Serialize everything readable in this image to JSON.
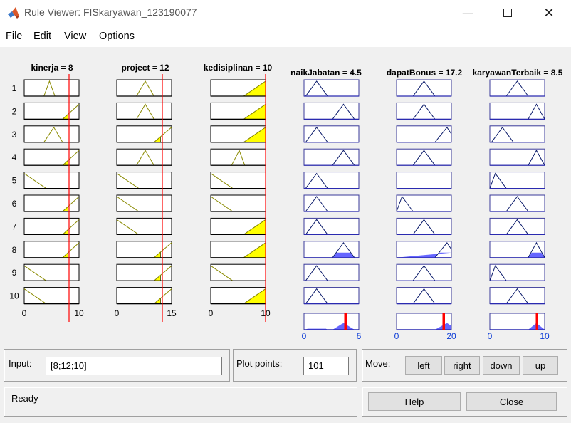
{
  "window": {
    "title": "Rule Viewer: FISkaryawan_123190077"
  },
  "menu": [
    "File",
    "Edit",
    "View",
    "Options"
  ],
  "columns": [
    {
      "label": "kinerja = 8",
      "range": [
        "0",
        "10"
      ]
    },
    {
      "label": "project = 12",
      "range": [
        "0",
        "15"
      ]
    },
    {
      "label": "kedisiplinan = 10",
      "range": [
        "0",
        "10"
      ]
    },
    {
      "label": "naikJabatan = 4.5",
      "range": [
        "0",
        "6"
      ]
    },
    {
      "label": "dapatBonus = 17.2",
      "range": [
        "0",
        "20"
      ]
    },
    {
      "label": "karyawanTerbaik = 8.5",
      "range": [
        "0",
        "10"
      ]
    }
  ],
  "rule_numbers": [
    "1",
    "2",
    "3",
    "4",
    "5",
    "6",
    "7",
    "8",
    "9",
    "10"
  ],
  "input": {
    "label": "Input:",
    "value": "[8;12;10]"
  },
  "plot_points": {
    "label": "Plot points:",
    "value": "101"
  },
  "move": {
    "label": "Move:",
    "buttons": [
      "left",
      "right",
      "down",
      "up"
    ]
  },
  "status": "Ready",
  "buttons": {
    "help": "Help",
    "close": "Close"
  },
  "colors": {
    "input_fill": "#ffff00",
    "output_fill": "#6666ff",
    "indicator": "#ff0000",
    "mf_input": "#8a8a00",
    "mf_output": "#0a1a6a"
  }
}
